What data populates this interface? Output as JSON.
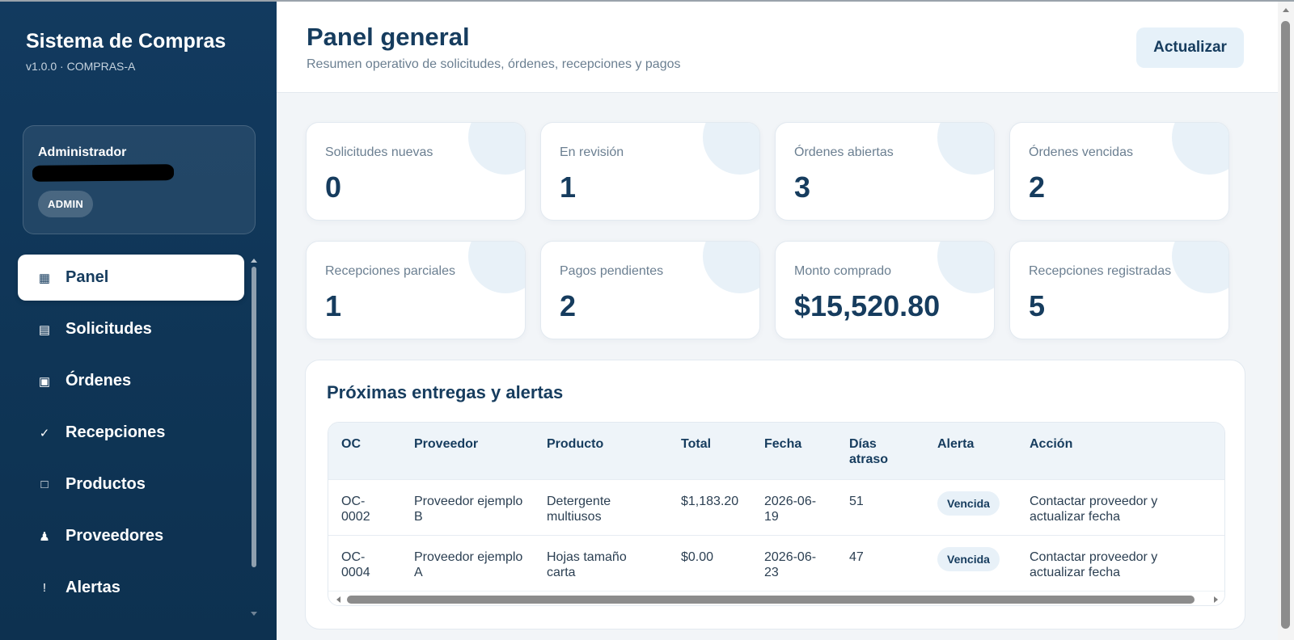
{
  "sidebar": {
    "brand_title": "Sistema de Compras",
    "version": "v1.0.0 · COMPRAS-A",
    "user": {
      "role": "Administrador",
      "badge": "ADMIN"
    },
    "nav": [
      {
        "label": "Panel",
        "icon": "grid-icon",
        "glyph": "▦",
        "active": true
      },
      {
        "label": "Solicitudes",
        "icon": "list-icon",
        "glyph": "▤",
        "active": false
      },
      {
        "label": "Órdenes",
        "icon": "order-icon",
        "glyph": "▣",
        "active": false
      },
      {
        "label": "Recepciones",
        "icon": "check-icon",
        "glyph": "✓",
        "active": false
      },
      {
        "label": "Productos",
        "icon": "box-icon",
        "glyph": "□",
        "active": false
      },
      {
        "label": "Proveedores",
        "icon": "person-icon",
        "glyph": "♟",
        "active": false
      },
      {
        "label": "Alertas",
        "icon": "exclamation-icon",
        "glyph": "!",
        "active": false
      }
    ]
  },
  "header": {
    "title": "Panel general",
    "subtitle": "Resumen operativo de solicitudes, órdenes, recepciones y pagos",
    "refresh_label": "Actualizar"
  },
  "stats": [
    {
      "label": "Solicitudes nuevas",
      "value": "0"
    },
    {
      "label": "En revisión",
      "value": "1"
    },
    {
      "label": "Órdenes abiertas",
      "value": "3"
    },
    {
      "label": "Órdenes vencidas",
      "value": "2"
    },
    {
      "label": "Recepciones parciales",
      "value": "1"
    },
    {
      "label": "Pagos pendientes",
      "value": "2"
    },
    {
      "label": "Monto comprado",
      "value": "$15,520.80"
    },
    {
      "label": "Recepciones registradas",
      "value": "5"
    }
  ],
  "alerts_panel": {
    "title": "Próximas entregas y alertas",
    "columns": [
      "OC",
      "Proveedor",
      "Producto",
      "Total",
      "Fecha",
      "Días atraso",
      "Alerta",
      "Acción"
    ],
    "rows": [
      [
        "OC-0002",
        "Proveedor ejemplo B",
        "Detergente multiusos",
        "$1,183.20",
        "2026-06-19",
        "51",
        "Vencida",
        "Contactar proveedor y actualizar fecha"
      ],
      [
        "OC-0004",
        "Proveedor ejemplo A",
        "Hojas tamaño carta",
        "$0.00",
        "2026-06-23",
        "47",
        "Vencida",
        "Contactar proveedor y actualizar fecha"
      ]
    ]
  }
}
